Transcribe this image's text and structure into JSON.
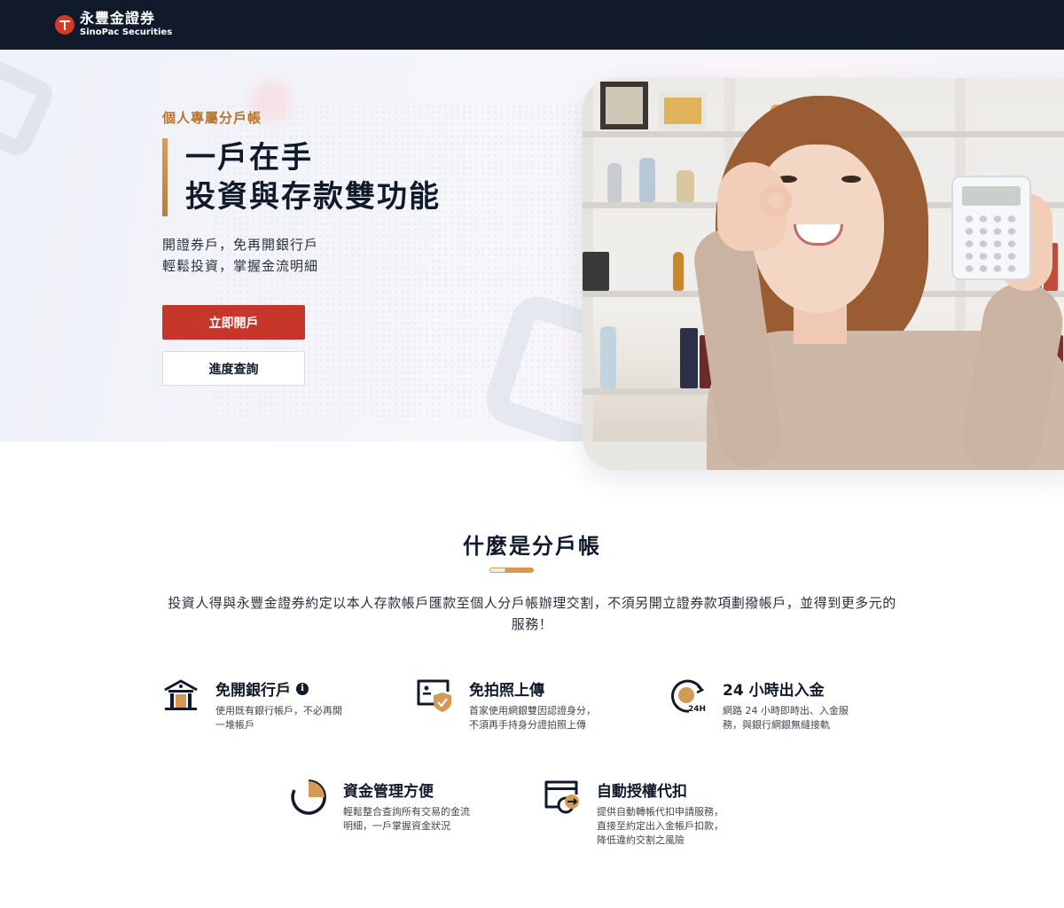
{
  "header": {
    "brand_zh": "永豐金證券",
    "brand_en": "SinoPac Securities",
    "brand_color": "#d53a25",
    "bar_color": "#111a2a"
  },
  "hero": {
    "tag": "個人專屬分戶帳",
    "title_line1": "一戶在手",
    "title_line2": "投資與存款雙功能",
    "subtitle_line1": "開證券戶，免再開銀行戶",
    "subtitle_line2": "輕鬆投資，掌握金流明細",
    "primary_button": "立即開戶",
    "secondary_button": "進度查詢",
    "accent_color": "#c6362a",
    "gold_color": "#b8742c"
  },
  "intro": {
    "title": "什麼是分戶帳",
    "description": "投資人得與永豐金證券約定以本人存款帳戶匯款至個人分戶帳辦理交割，不須另開立證券款項劃撥帳戶，並得到更多元的服務！"
  },
  "features": [
    {
      "icon": "bank-icon",
      "title": "免開銀行戶",
      "has_info": true,
      "info_symbol": "i",
      "description": "使用既有銀行帳戶，不必再開\n一堆帳戶"
    },
    {
      "icon": "id-card-shield-icon",
      "title": "免拍照上傳",
      "description": "首家使用網銀雙因認證身分，\n不須再手持身分證拍照上傳"
    },
    {
      "icon": "clock-24h-icon",
      "title": "24 小時出入金",
      "icon_label": "24H",
      "description": "網路 24 小時即時出、入金服\n務，與銀行網銀無縫接軌"
    },
    {
      "icon": "pie-chart-icon",
      "title": "資金管理方便",
      "description": "輕鬆整合查詢所有交易的金流\n明細，一戶掌握資金狀況"
    },
    {
      "icon": "auto-debit-icon",
      "title": "自動授權代扣",
      "description": "提供自動轉帳代扣申請服務，\n直接至約定出入金帳戶扣款，\n降低違約交割之風險"
    }
  ]
}
